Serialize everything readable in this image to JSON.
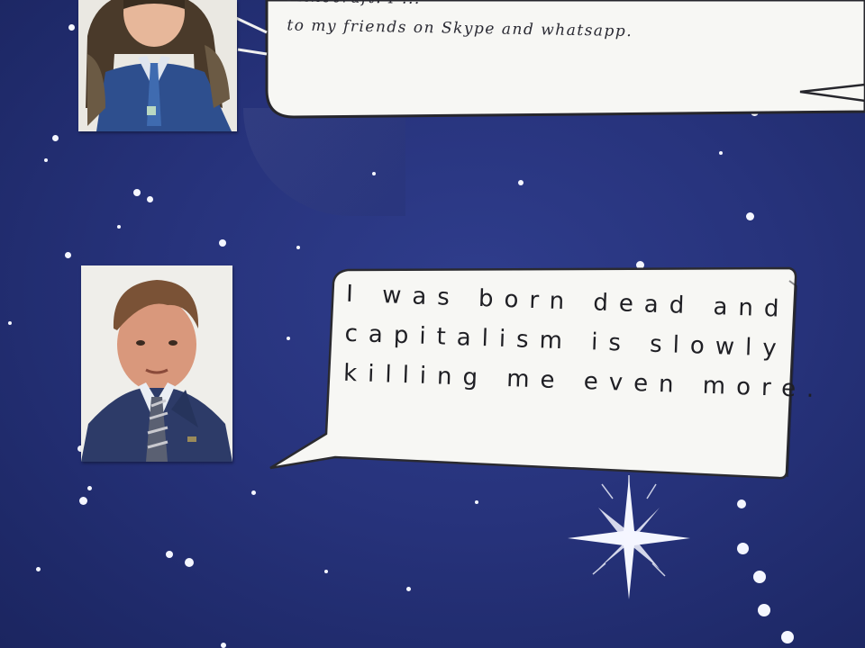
{
  "scene": {
    "kind": "space-themed classroom poster with school portraits and speech bubbles",
    "colors": {
      "background": "#27337c",
      "stars": "#f4f6ff",
      "paper": "#f7f7f4",
      "ink": "#1f1f24"
    }
  },
  "top_bubble": {
    "lines": [
      "Minecraft. I ...",
      "to my friends on Skype and whatsapp."
    ]
  },
  "lower_bubble": {
    "lines": [
      "I was born dead and",
      "capitalism is slowly",
      "killing me even more."
    ]
  },
  "portraits": [
    {
      "name": "girl-portrait",
      "subject": "girl in school uniform, blue cardigan, white shirt, tie"
    },
    {
      "name": "boy-portrait",
      "subject": "boy in school blazer, white shirt, striped tie"
    }
  ],
  "decor": {
    "large_star": "eight-point white sparkle",
    "small_stars": "scattered white dots"
  }
}
